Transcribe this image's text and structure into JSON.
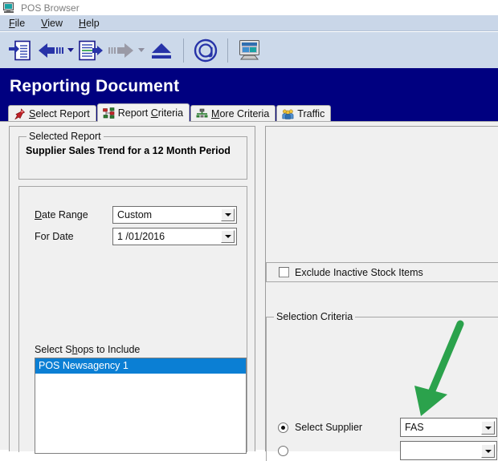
{
  "window": {
    "title": "POS Browser",
    "icon": "computer-monitor-icon"
  },
  "menubar": {
    "items": [
      {
        "label": "File",
        "accel": "F"
      },
      {
        "label": "View",
        "accel": "V"
      },
      {
        "label": "Help",
        "accel": "H"
      }
    ]
  },
  "toolbar": {
    "buttons": [
      {
        "name": "import-document-button",
        "icon": "document-import-icon",
        "enabled": true
      },
      {
        "name": "back-button",
        "icon": "back-arrow-icon",
        "enabled": true
      },
      {
        "name": "back-dropdown-button",
        "icon": "chevron-down-icon",
        "enabled": true
      },
      {
        "name": "export-document-button",
        "icon": "document-export-icon",
        "enabled": true
      },
      {
        "name": "forward-button",
        "icon": "forward-arrow-icon",
        "enabled": false
      },
      {
        "name": "forward-dropdown-button",
        "icon": "chevron-down-icon",
        "enabled": false
      },
      {
        "name": "eject-button",
        "icon": "eject-icon",
        "enabled": true
      },
      {
        "name": "email-button",
        "icon": "at-sign-icon",
        "enabled": true
      },
      {
        "name": "browser-button",
        "icon": "computer-monitor-icon",
        "enabled": true
      }
    ]
  },
  "header": {
    "title": "Reporting Document",
    "background": "#000080"
  },
  "tabs": [
    {
      "label": "Select Report",
      "accel": "S",
      "icon": "pushpin-icon",
      "active": false
    },
    {
      "label": "Report Criteria",
      "accel": "C",
      "icon": "hierarchy-icon",
      "active": true
    },
    {
      "label": "More Criteria",
      "accel": "M",
      "icon": "connector-icon",
      "active": false
    },
    {
      "label": "Traffic",
      "accel": "",
      "icon": "people-icon",
      "active": false
    }
  ],
  "left_panel": {
    "selected_report": {
      "legend": "Selected Report",
      "value": "Supplier Sales Trend for a 12 Month Period"
    },
    "date_range": {
      "label": "Date Range",
      "accel": "D",
      "value": "Custom"
    },
    "for_date": {
      "label": "For Date",
      "accel": "",
      "value": "1 /01/2016"
    },
    "shops": {
      "label": "Select Shops to Include",
      "accel": "h",
      "items": [
        {
          "label": "POS Newsagency 1",
          "selected": true
        }
      ],
      "selected_color": "#0b7fd4"
    }
  },
  "right_panel": {
    "exclude_inactive": {
      "label": "Exclude Inactive Stock Items",
      "checked": false
    },
    "selection_criteria": {
      "legend": "Selection Criteria",
      "select_supplier": {
        "label": "Select Supplier",
        "checked": true,
        "value": "FAS"
      }
    }
  },
  "annotation": {
    "type": "arrow",
    "color": "#2ba24c",
    "points_to": "supplier-combo"
  }
}
